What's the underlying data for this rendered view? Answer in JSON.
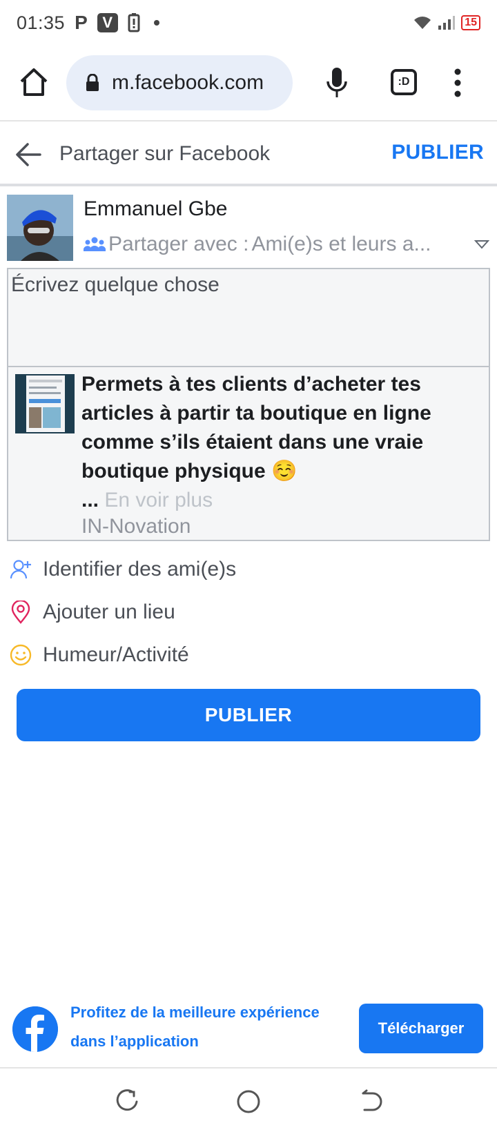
{
  "status_bar": {
    "time": "01:35",
    "notif_p": "P",
    "notif_v": "V",
    "notif_alert": "!",
    "battery": "15"
  },
  "browser": {
    "url": "m.facebook.com",
    "tab_label": ":D"
  },
  "share_header": {
    "title": "Partager sur Facebook",
    "publish_label": "PUBLIER"
  },
  "author": {
    "name": "Emmanuel Gbe",
    "audience_label": "Partager avec :",
    "audience_value": "Ami(e)s et leurs a..."
  },
  "composer": {
    "placeholder": "Écrivez quelque chose"
  },
  "preview": {
    "text": "Permets à tes clients d’acheter tes articles à partir ta boutique en ligne comme s’ils étaient dans une vraie boutique physique ☺️",
    "ellipsis": "...",
    "see_more": "En voir plus",
    "source": "IN-Novation"
  },
  "actions": [
    {
      "label": "Identifier des ami(e)s",
      "icon": "tag-friends-icon",
      "color": "#5890ff"
    },
    {
      "label": "Ajouter un lieu",
      "icon": "location-pin-icon",
      "color": "#e0245e"
    },
    {
      "label": "Humeur/Activité",
      "icon": "smiley-icon",
      "color": "#f7b928"
    }
  ],
  "publish_button": {
    "label": "PUBLIER"
  },
  "promo": {
    "text": "Profitez de la meilleure expérience dans l’application",
    "download_label": "Télécharger"
  },
  "colors": {
    "brand": "#1877f2",
    "composer_bg": "#f5f6f7",
    "border": "#bec3c9"
  }
}
